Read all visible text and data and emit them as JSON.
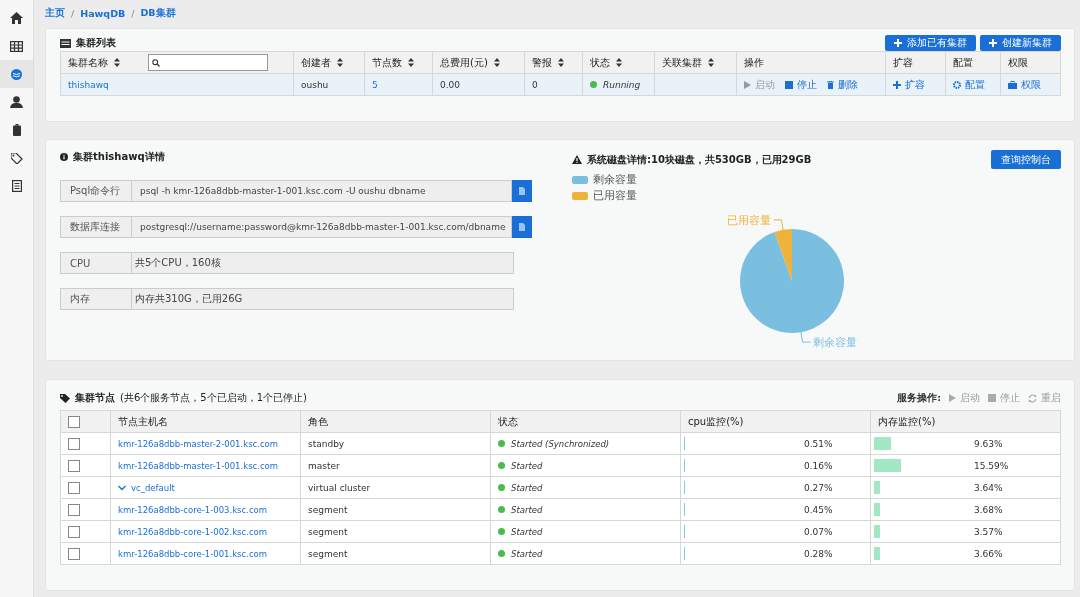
{
  "sidebar": {
    "items": [
      {
        "kind": "home",
        "selected": false
      },
      {
        "kind": "table",
        "selected": false
      },
      {
        "kind": "database",
        "selected": true
      },
      {
        "kind": "user",
        "selected": false
      },
      {
        "kind": "battery",
        "selected": false
      },
      {
        "kind": "tags",
        "selected": false
      },
      {
        "kind": "document",
        "selected": false
      }
    ]
  },
  "breadcrumb": {
    "separator": "/",
    "items": [
      "主页",
      "HawqDB",
      "DB集群"
    ]
  },
  "cluster_list": {
    "title": "集群列表",
    "buttons": [
      "添加已有集群",
      "创建新集群"
    ],
    "columns": [
      {
        "label": "集群名称",
        "sortable": true,
        "search": true
      },
      {
        "label": "创建者",
        "sortable": true
      },
      {
        "label": "节点数",
        "sortable": true
      },
      {
        "label": "总费用(元)",
        "sortable": true
      },
      {
        "label": "警报",
        "sortable": true
      },
      {
        "label": "状态",
        "sortable": true
      },
      {
        "label": "关联集群",
        "sortable": true
      },
      {
        "label": "操作",
        "sortable": false
      },
      {
        "label": "扩容",
        "sortable": false
      },
      {
        "label": "配置",
        "sortable": false
      },
      {
        "label": "权限",
        "sortable": false
      }
    ],
    "rows": [
      {
        "name": "thishawq",
        "creator": "oushu",
        "nodes": "5",
        "cost": "0.00",
        "alerts": "0",
        "status": "Running",
        "actions": [
          {
            "kind": "start",
            "label": "启动",
            "disabled": true
          },
          {
            "kind": "stop",
            "label": "停止",
            "disabled": false
          },
          {
            "kind": "delete",
            "label": "删除",
            "disabled": false
          }
        ],
        "expand": "扩容",
        "config": "配置",
        "permission": "权限"
      }
    ]
  },
  "details": {
    "title": "集群thishawq详情",
    "fields": [
      {
        "label": "Psql命令行",
        "value": "psql -h kmr-126a8dbb-master-1-001.ksc.com -U oushu dbname",
        "copyable": true
      },
      {
        "label": "数据库连接",
        "value": "postgresql://username:password@kmr-126a8dbb-master-1-001.ksc.com/dbname",
        "copyable": true
      },
      {
        "label": "CPU",
        "value": "共5个CPU，160核",
        "copyable": false
      },
      {
        "label": "内存",
        "value": "内存共310G，已用26G",
        "copyable": false
      }
    ]
  },
  "disk": {
    "title": "系统磁盘详情:10块磁盘，共530GB，已用29GB",
    "button": "查询控制台",
    "chart_data": {
      "type": "pie",
      "categories": [
        "剩余容量",
        "已用容量"
      ],
      "values": [
        94.53,
        5.47
      ],
      "colors": [
        "#7bbfe0",
        "#efb23a"
      ]
    }
  },
  "nodes": {
    "title": "集群节点",
    "summary": "(共6个服务节点，5个已启动，1个已停止)",
    "service_ops": {
      "label": "服务操作:",
      "actions": [
        {
          "kind": "start",
          "label": "启动"
        },
        {
          "kind": "stop",
          "label": "停止"
        },
        {
          "kind": "restart",
          "label": "重启"
        }
      ]
    },
    "all_checked": false,
    "columns": [
      "节点主机名",
      "角色",
      "状态",
      "cpu监控(%)",
      "内存监控(%)"
    ],
    "rows": [
      {
        "kind": "host",
        "host": "kmr-126a8dbb-master-2-001.ksc.com",
        "role": "standby",
        "status": "Started (Synchronized)",
        "checked": false,
        "cpu": {
          "reading": "0.51%",
          "level": 0.0051
        },
        "mem": {
          "reading": "9.63%",
          "level": 0.0963
        }
      },
      {
        "kind": "host",
        "host": "kmr-126a8dbb-master-1-001.ksc.com",
        "role": "master",
        "status": "Started",
        "checked": false,
        "cpu": {
          "reading": "0.16%",
          "level": 0.0016
        },
        "mem": {
          "reading": "15.59%",
          "level": 0.1559
        }
      },
      {
        "kind": "group",
        "host": "vc_default",
        "expanded": true,
        "role": "virtual cluster",
        "status": "Started",
        "checked": false,
        "cpu": {
          "reading": "0.27%",
          "level": 0.0027
        },
        "mem": {
          "reading": "3.64%",
          "level": 0.0364
        }
      },
      {
        "kind": "host",
        "host": "kmr-126a8dbb-core-1-003.ksc.com",
        "role": "segment",
        "status": "Started",
        "checked": false,
        "cpu": {
          "reading": "0.45%",
          "level": 0.0045
        },
        "mem": {
          "reading": "3.68%",
          "level": 0.0368
        }
      },
      {
        "kind": "host",
        "host": "kmr-126a8dbb-core-1-002.ksc.com",
        "role": "segment",
        "status": "Started",
        "checked": false,
        "cpu": {
          "reading": "0.07%",
          "level": 0.0007
        },
        "mem": {
          "reading": "3.57%",
          "level": 0.0357
        }
      },
      {
        "kind": "host",
        "host": "kmr-126a8dbb-core-1-001.ksc.com",
        "role": "segment",
        "status": "Started",
        "checked": false,
        "cpu": {
          "reading": "0.28%",
          "level": 0.0028
        },
        "mem": {
          "reading": "3.66%",
          "level": 0.0366
        }
      }
    ]
  }
}
